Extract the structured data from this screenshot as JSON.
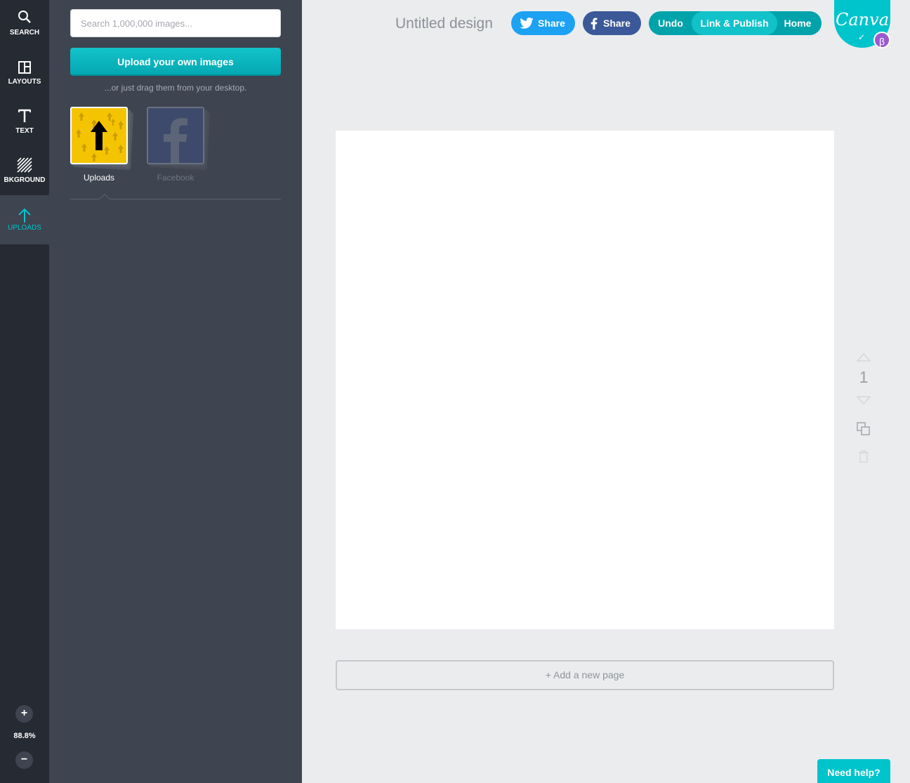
{
  "rail": {
    "items": [
      {
        "label": "SEARCH",
        "icon": "search-icon"
      },
      {
        "label": "LAYOUTS",
        "icon": "layouts-icon"
      },
      {
        "label": "TEXT",
        "icon": "text-icon"
      },
      {
        "label": "BKGROUND",
        "icon": "background-icon"
      },
      {
        "label": "UPLOADS",
        "icon": "upload-arrow-icon"
      }
    ],
    "zoom_in": "+",
    "zoom_value": "88.8%",
    "zoom_out": "−"
  },
  "panel": {
    "search_placeholder": "Search 1,000,000 images...",
    "upload_button": "Upload your own images",
    "drag_hint": "...or just drag them from your desktop.",
    "folders": [
      {
        "label": "Uploads",
        "active": true
      },
      {
        "label": "Facebook",
        "active": false
      }
    ]
  },
  "topbar": {
    "title": "Untitled design",
    "twitter_share": "Share",
    "facebook_share": "Share",
    "undo": "Undo",
    "link_publish": "Link & Publish",
    "home": "Home",
    "logo_text": "Canva",
    "logo_check": "✓",
    "beta": "β"
  },
  "canvas": {
    "page_number": "1",
    "add_page": "+ Add a new page"
  },
  "help": "Need help?",
  "colors": {
    "accent": "#00c4cc",
    "twitter": "#1da1f2",
    "facebook": "#3b5998",
    "beta": "#9b59d0"
  }
}
